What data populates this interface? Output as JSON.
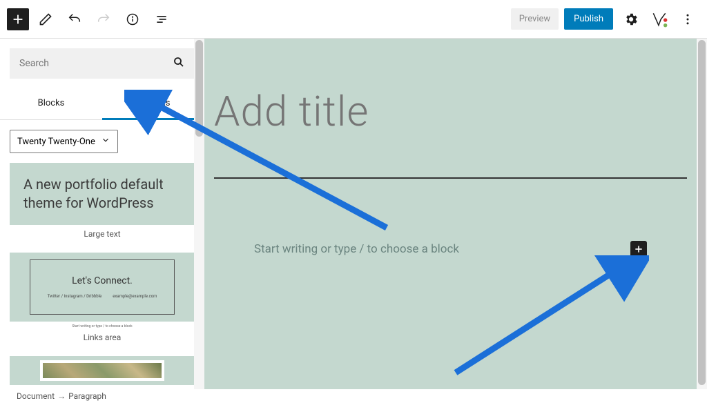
{
  "toolbar": {
    "preview_label": "Preview",
    "publish_label": "Publish"
  },
  "sidebar": {
    "search_placeholder": "Search",
    "tabs": {
      "blocks": "Blocks",
      "patterns": "Patterns"
    },
    "theme_selected": "Twenty Twenty-One",
    "patterns": [
      {
        "preview_text": "A new portfolio default theme for WordPress",
        "label": "Large text"
      },
      {
        "preview_title": "Let's Connect.",
        "preview_links": "Twitter / Instagram / Dribbble",
        "preview_email": "example@example.com",
        "preview_sub": "Start writing or type / to choose a block",
        "label": "Links area"
      }
    ]
  },
  "editor": {
    "title_placeholder": "Add title",
    "block_placeholder": "Start writing or type / to choose a block"
  },
  "breadcrumb": {
    "document": "Document",
    "paragraph": "Paragraph"
  },
  "colors": {
    "accent": "#007cba",
    "canvas_bg": "#c4d8cf"
  }
}
